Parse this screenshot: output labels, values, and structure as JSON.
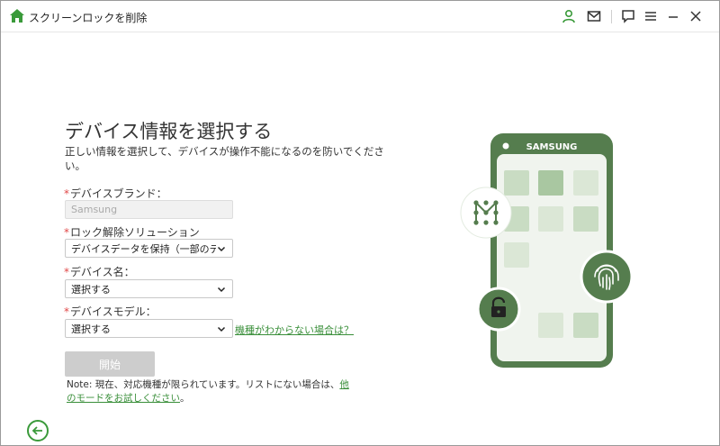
{
  "window": {
    "title": "スクリーンロックを削除"
  },
  "titlebar_icons": [
    "home-icon",
    "user-icon",
    "mail-icon",
    "feedback-icon",
    "menu-icon",
    "minimize-icon",
    "close-icon"
  ],
  "colors": {
    "accent": "#3a9a3a",
    "phone_body": "#557d4e",
    "phone_screen": "#f0f4ee",
    "tile": "#c9dcc3",
    "tile_dark": "#a9c7a1",
    "required": "#e04848",
    "disabled_button": "#cdcdcd"
  },
  "main": {
    "heading": "デバイス情報を選択する",
    "subtitle": "正しい情報を選択して、デバイスが操作不能になるのを防いでくださ い。"
  },
  "form": {
    "required_mark": "*",
    "brand": {
      "label": "デバイスブランド：",
      "value": "Samsung"
    },
    "solution": {
      "label": "ロック解除ソリューション",
      "value": "デバイスデータを保持（一部のデバ"
    },
    "device_name": {
      "label": "デバイス名：",
      "value": "選択する"
    },
    "device_model": {
      "label": "デバイスモデル：",
      "value": "選択する"
    },
    "help_link": "機種がわからない場合は？"
  },
  "start_button": "開始",
  "note": {
    "text": "Note: 現在、対応機種が限られています。リストにない場合は、",
    "link_part1": "他",
    "link_part2": "のモードをお試しください",
    "suffix": "。"
  },
  "illustration": {
    "phone_brand": "SAMSUNG",
    "icons": [
      "pattern-lock-icon",
      "fingerprint-icon",
      "padlock-icon"
    ]
  }
}
